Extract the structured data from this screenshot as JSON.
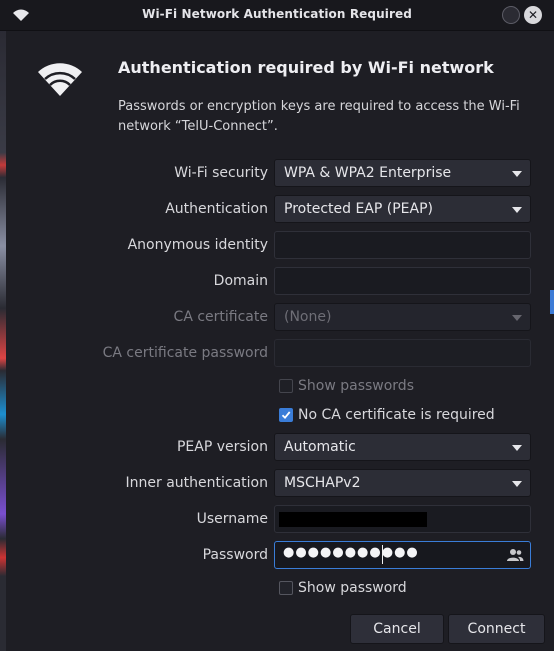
{
  "window": {
    "title": "Wi-Fi Network Authentication Required"
  },
  "header": {
    "title": "Authentication required by Wi-Fi network",
    "message": "Passwords or encryption keys are required to access the Wi-Fi network “TelU-Connect”."
  },
  "form": {
    "wifi_security": {
      "label": "Wi-Fi security",
      "value": "WPA & WPA2 Enterprise"
    },
    "authentication": {
      "label": "Authentication",
      "value": "Protected EAP (PEAP)"
    },
    "anonymous_identity": {
      "label": "Anonymous identity",
      "value": ""
    },
    "domain": {
      "label": "Domain",
      "value": ""
    },
    "ca_certificate": {
      "label": "CA certificate",
      "value": "(None)"
    },
    "ca_certificate_password": {
      "label": "CA certificate password",
      "value": ""
    },
    "show_passwords": {
      "label": "Show passwords",
      "checked": false
    },
    "no_ca_required": {
      "label": "No CA certificate is required",
      "checked": true
    },
    "peap_version": {
      "label": "PEAP version",
      "value": "Automatic"
    },
    "inner_authentication": {
      "label": "Inner authentication",
      "value": "MSCHAPv2"
    },
    "username": {
      "label": "Username"
    },
    "password": {
      "label": "Password",
      "masked": "●●●●●●●●●●●"
    },
    "show_password": {
      "label": "Show password",
      "checked": false
    }
  },
  "buttons": {
    "cancel": "Cancel",
    "connect": "Connect"
  },
  "colors": {
    "accent": "#3a7dd8",
    "background": "#1e1e24",
    "titlebar": "#18181d"
  },
  "icons": {
    "title_icon": "wifi-icon",
    "header_icon": "wifi-signal-icon",
    "password_icon": "user-group-icon",
    "close_icon": "close-icon"
  }
}
